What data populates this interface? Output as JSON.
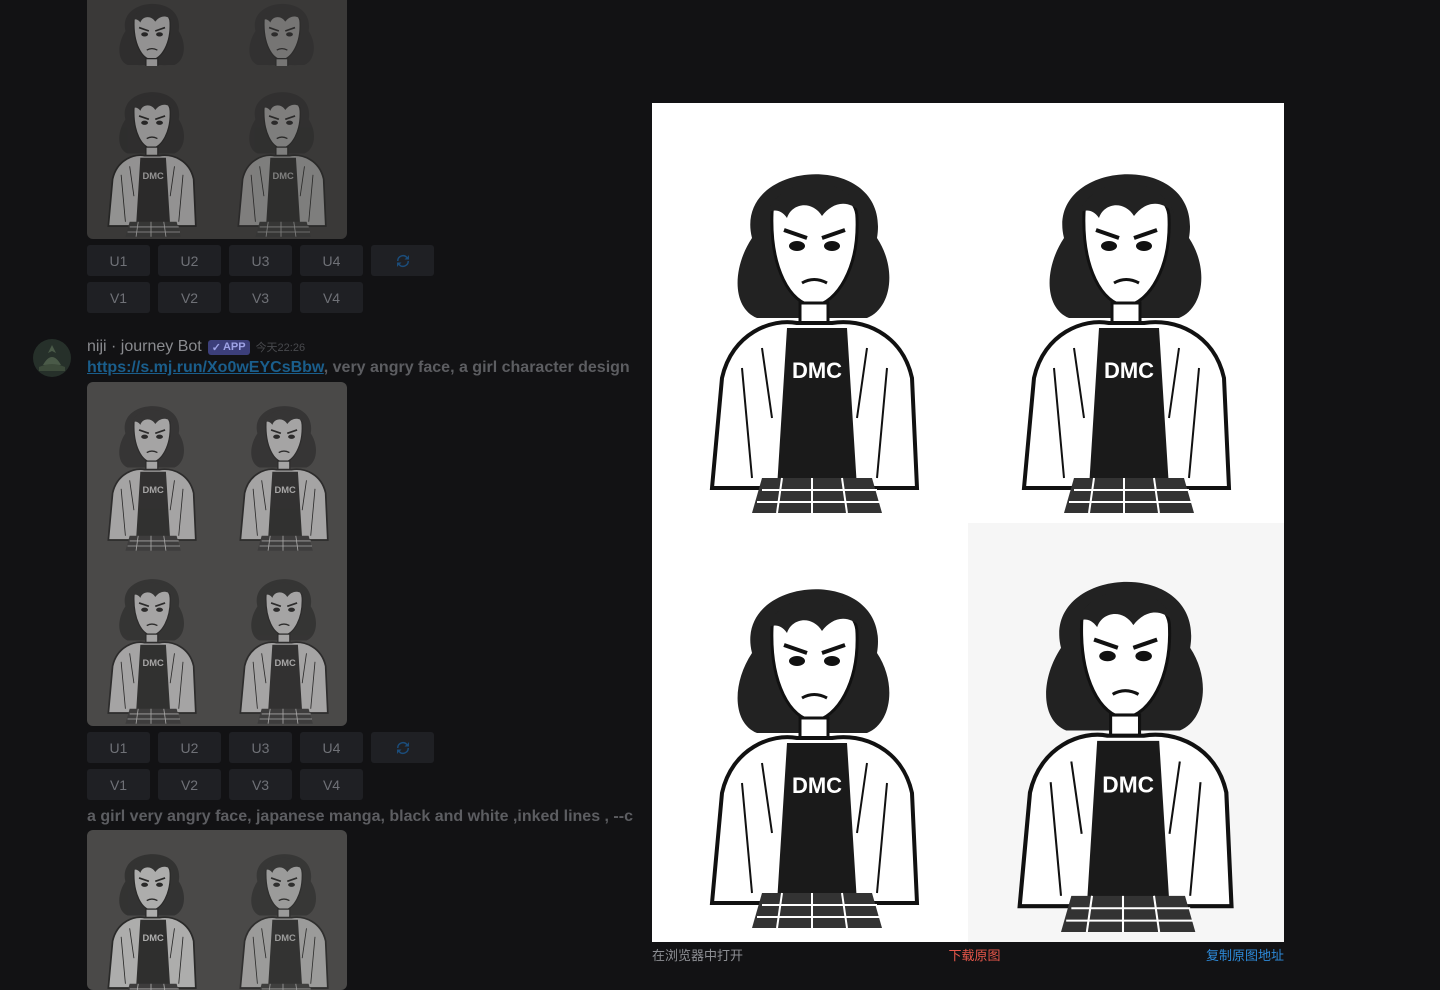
{
  "buttons": {
    "upscale": [
      "U1",
      "U2",
      "U3",
      "U4"
    ],
    "variation": [
      "V1",
      "V2",
      "V3",
      "V4"
    ],
    "refresh_icon": "refresh-icon"
  },
  "message": {
    "author": "niji · journey Bot",
    "badge": "APP",
    "badge_icon": "checkmark-icon",
    "timestamp": "今天22:26",
    "link": "https://s.mj.run/Xo0wEYCsBbw",
    "prompt": ", very angry face, a girl character design"
  },
  "next_message": {
    "prompt": "a girl very angry face, japanese manga, black and white ,inked lines , --c"
  },
  "viewer": {
    "open_in_browser": "在浏览器中打开",
    "download_original": "下载原图",
    "copy_original_url": "复制原图地址"
  },
  "colors": {
    "background": "#121214",
    "download": "#e8574a",
    "copy": "#2d8ad9",
    "link": "#1a5e8c"
  }
}
